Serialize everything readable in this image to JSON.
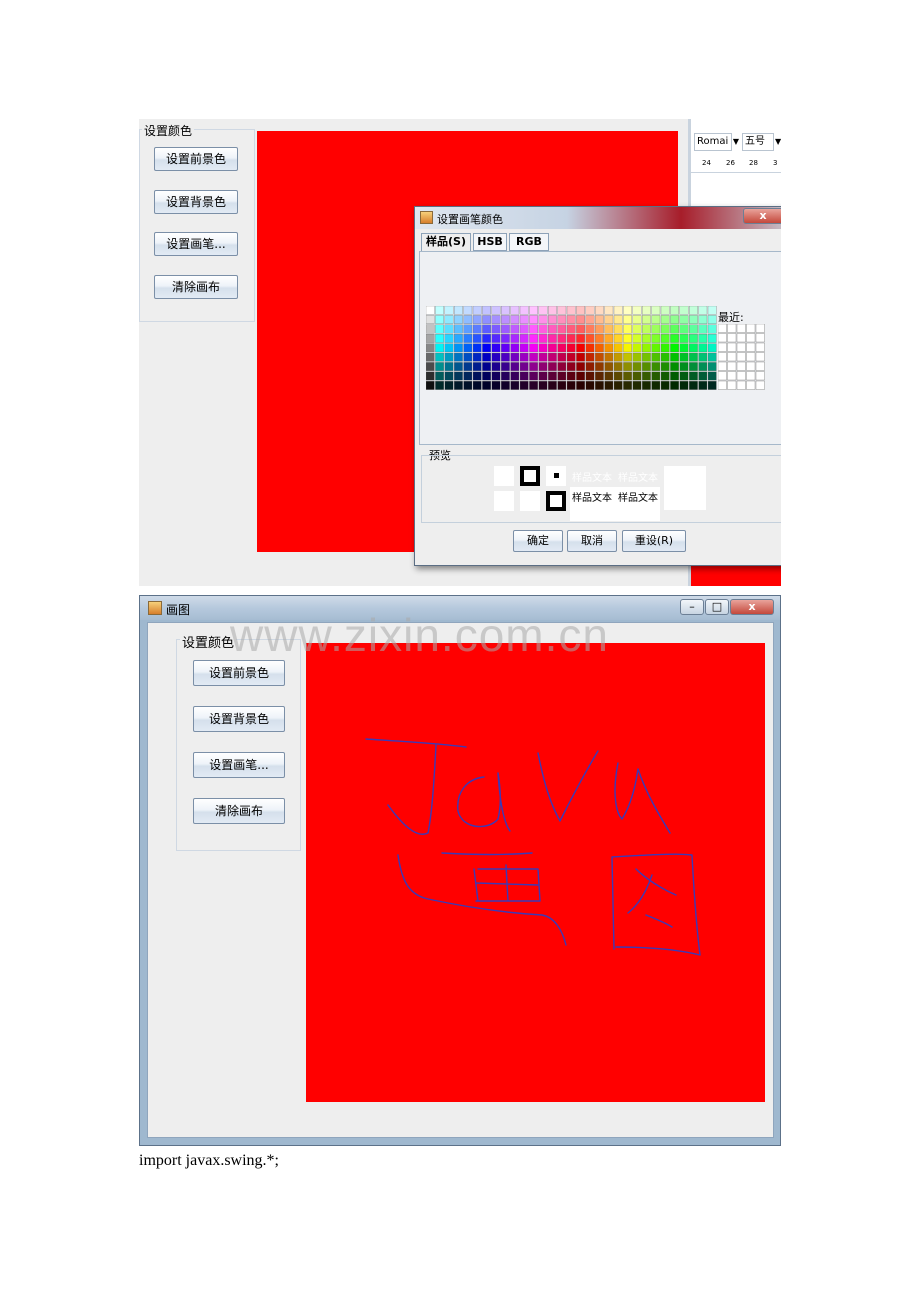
{
  "top_window": {
    "group_title": "设置颜色",
    "buttons": [
      "设置前景色",
      "设置背景色",
      "设置画笔...",
      "清除画布"
    ],
    "word_toolbar": {
      "font_name": "Romai",
      "font_size": "五号",
      "ruler": [
        "24",
        "26",
        "28",
        "3"
      ]
    },
    "canvas_color": "#ff0000"
  },
  "color_chooser": {
    "title": "设置画笔颜色",
    "close_label": "x",
    "tabs": [
      "样品(S)",
      "HSB",
      "RGB"
    ],
    "recent_label": "最近:",
    "preview_label": "预览",
    "sample_text": "样品文本",
    "buttons": {
      "ok": "确定",
      "cancel": "取消",
      "reset": "重设(R)"
    }
  },
  "bottom_window": {
    "title": "画图",
    "group_title": "设置颜色",
    "buttons": [
      "设置前景色",
      "设置背景色",
      "设置画笔...",
      "清除画布"
    ],
    "canvas_color": "#ff0000",
    "stroke_color": "#3a3ab8"
  },
  "watermark": "www.zixin.com.cn",
  "code_line": "import javax.swing.*;"
}
